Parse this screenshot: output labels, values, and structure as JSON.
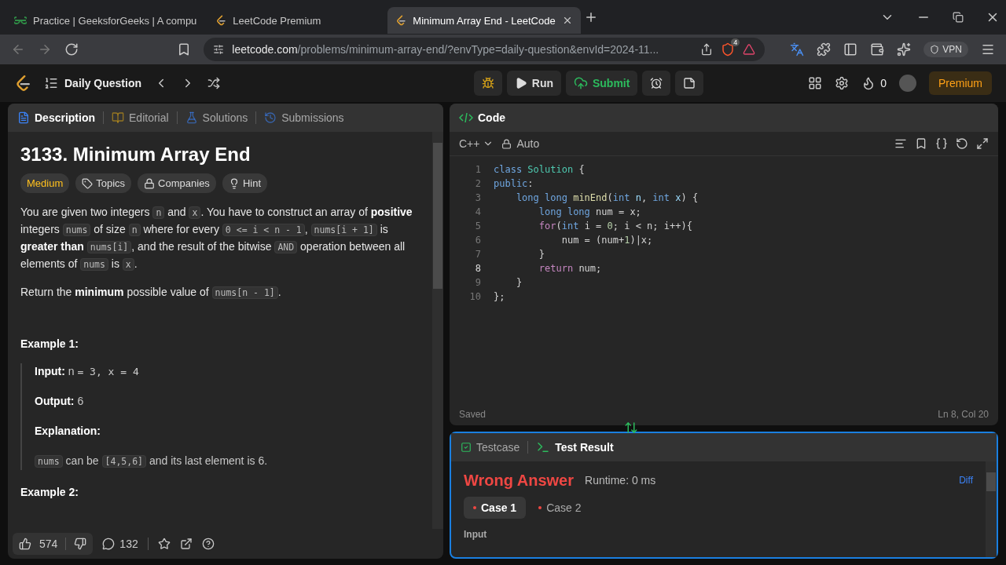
{
  "browser": {
    "tabs": [
      {
        "title": "Practice | GeeksforGeeks | A compu",
        "selected": false,
        "kind": "gfg"
      },
      {
        "title": "LeetCode Premium",
        "selected": false,
        "kind": "leetcode"
      },
      {
        "title": "Minimum Array End - LeetCode",
        "selected": true,
        "kind": "leetcode"
      }
    ],
    "url": {
      "host": "leetcode.com",
      "path": "/problems/minimum-array-end/?envType=daily-question&envId=2024-11..."
    },
    "shield_badge": "4",
    "vpn": "VPN"
  },
  "app_bar": {
    "title": "Daily Question",
    "run": "Run",
    "submit": "Submit",
    "streak": "0",
    "premium": "Premium"
  },
  "left_panel": {
    "tabs": [
      {
        "label": "Description",
        "selected": true,
        "kind": "description"
      },
      {
        "label": "Editorial",
        "selected": false,
        "kind": "editorial"
      },
      {
        "label": "Solutions",
        "selected": false,
        "kind": "solutions"
      },
      {
        "label": "Submissions",
        "selected": false,
        "kind": "submissions"
      }
    ],
    "title": "3133. Minimum Array End",
    "tags": [
      {
        "label": "Medium",
        "kind": "difficulty"
      },
      {
        "label": "Topics",
        "kind": "topics"
      },
      {
        "label": "Companies",
        "kind": "companies"
      },
      {
        "label": "Hint",
        "kind": "hint"
      }
    ],
    "paragraphs": [
      [
        {
          "kind": "text",
          "text": "You are given two integers "
        },
        {
          "kind": "code",
          "text": "n"
        },
        {
          "kind": "text",
          "text": " and "
        },
        {
          "kind": "code",
          "text": "x"
        },
        {
          "kind": "text",
          "text": ". You have to construct an array of "
        },
        {
          "kind": "bold",
          "text": "positive"
        },
        {
          "kind": "text",
          "text": " integers "
        },
        {
          "kind": "code",
          "text": "nums"
        },
        {
          "kind": "text",
          "text": " of size "
        },
        {
          "kind": "code",
          "text": "n"
        },
        {
          "kind": "text",
          "text": " where for every "
        },
        {
          "kind": "code",
          "text": "0 <= i < n - 1"
        },
        {
          "kind": "text",
          "text": ", "
        },
        {
          "kind": "code",
          "text": "nums[i + 1]"
        },
        {
          "kind": "text",
          "text": " is "
        },
        {
          "kind": "bold",
          "text": "greater than "
        },
        {
          "kind": "code",
          "text": "nums[i]"
        },
        {
          "kind": "text",
          "text": ", and the result of the bitwise "
        },
        {
          "kind": "code",
          "text": "AND"
        },
        {
          "kind": "text",
          "text": " operation between all elements of "
        },
        {
          "kind": "code",
          "text": "nums"
        },
        {
          "kind": "text",
          "text": " is "
        },
        {
          "kind": "code",
          "text": "x"
        },
        {
          "kind": "text",
          "text": "."
        }
      ],
      [
        {
          "kind": "text",
          "text": "Return the "
        },
        {
          "kind": "bold",
          "text": "minimum"
        },
        {
          "kind": "text",
          "text": " possible value of "
        },
        {
          "kind": "code",
          "text": "nums[n - 1]"
        },
        {
          "kind": "text",
          "text": "."
        }
      ]
    ],
    "examples": [
      {
        "title": "Example 1:",
        "lines": [
          [
            {
              "kind": "bold",
              "text": "Input:"
            },
            {
              "kind": "text",
              "text": " n "
            },
            {
              "kind": "mono",
              "text": "= 3, x = 4"
            }
          ],
          [
            {
              "kind": "bold",
              "text": "Output:"
            },
            {
              "kind": "text",
              "text": " 6"
            }
          ],
          [
            {
              "kind": "bold",
              "text": "Explanation:"
            }
          ],
          [
            {
              "kind": "code",
              "text": "nums"
            },
            {
              "kind": "text",
              "text": " can be "
            },
            {
              "kind": "code",
              "text": "[4,5,6]"
            },
            {
              "kind": "text",
              "text": " and its last element is 6."
            }
          ]
        ]
      },
      {
        "title": "Example 2:"
      }
    ],
    "likes": "574",
    "comments": "132"
  },
  "code_panel": {
    "title": "Code",
    "language": "C++",
    "mode": "Auto",
    "lines": [
      {
        "number": "1",
        "current": false,
        "tokens": [
          {
            "kind": "keyword",
            "text": "class "
          },
          {
            "kind": "type",
            "text": "Solution"
          },
          {
            "kind": "plain",
            "text": " {"
          }
        ]
      },
      {
        "number": "2",
        "current": false,
        "tokens": [
          {
            "kind": "keyword",
            "text": "public"
          },
          {
            "kind": "plain",
            "text": ":"
          }
        ]
      },
      {
        "number": "3",
        "current": false,
        "tokens": [
          {
            "kind": "keyword",
            "text": "    long long "
          },
          {
            "kind": "func",
            "text": "minEnd"
          },
          {
            "kind": "plain",
            "text": "("
          },
          {
            "kind": "keyword",
            "text": "int "
          },
          {
            "kind": "param",
            "text": "n"
          },
          {
            "kind": "plain",
            "text": ", "
          },
          {
            "kind": "keyword",
            "text": "int "
          },
          {
            "kind": "param",
            "text": "x"
          },
          {
            "kind": "plain",
            "text": ") {"
          }
        ]
      },
      {
        "number": "4",
        "current": false,
        "tokens": [
          {
            "kind": "keyword",
            "text": "        long long "
          },
          {
            "kind": "plain",
            "text": "num = x;"
          }
        ]
      },
      {
        "number": "5",
        "current": false,
        "tokens": [
          {
            "kind": "control",
            "text": "        for"
          },
          {
            "kind": "plain",
            "text": "("
          },
          {
            "kind": "keyword",
            "text": "int "
          },
          {
            "kind": "plain",
            "text": "i = "
          },
          {
            "kind": "number",
            "text": "0"
          },
          {
            "kind": "plain",
            "text": "; i < n; i++){"
          }
        ]
      },
      {
        "number": "6",
        "current": false,
        "tokens": [
          {
            "kind": "plain",
            "text": "            num = (num+"
          },
          {
            "kind": "number",
            "text": "1"
          },
          {
            "kind": "plain",
            "text": ")|x;"
          }
        ]
      },
      {
        "number": "7",
        "current": false,
        "tokens": [
          {
            "kind": "plain",
            "text": "        }"
          }
        ]
      },
      {
        "number": "8",
        "current": true,
        "tokens": [
          {
            "kind": "control",
            "text": "        return "
          },
          {
            "kind": "plain",
            "text": "num;"
          }
        ]
      },
      {
        "number": "9",
        "current": false,
        "tokens": [
          {
            "kind": "plain",
            "text": "    }"
          }
        ]
      },
      {
        "number": "10",
        "current": false,
        "tokens": [
          {
            "kind": "plain",
            "text": "};"
          }
        ]
      }
    ],
    "status": "Saved",
    "cursor": "Ln 8, Col 20"
  },
  "result_panel": {
    "tabs": [
      {
        "label": "Testcase",
        "selected": false,
        "kind": "testcase"
      },
      {
        "label": "Test Result",
        "selected": true,
        "kind": "result"
      }
    ],
    "verdict": "Wrong Answer",
    "runtime": "Runtime: 0 ms",
    "diff": "Diff",
    "cases": [
      {
        "label": "Case 1",
        "selected": true
      },
      {
        "label": "Case 2",
        "selected": false
      }
    ],
    "input_label": "Input"
  }
}
